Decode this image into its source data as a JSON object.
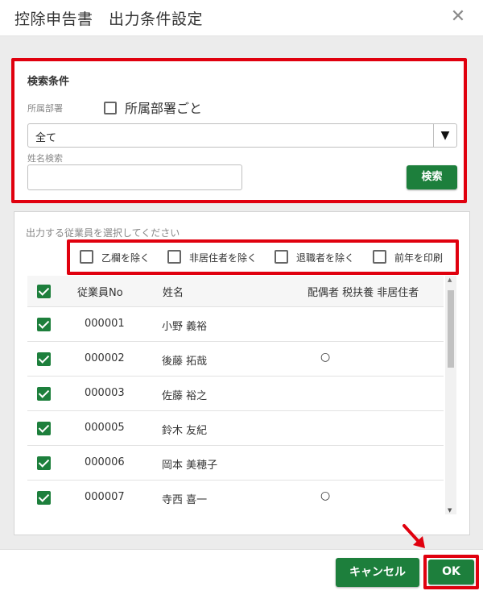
{
  "dialog": {
    "title": "控除申告書　出力条件設定",
    "close_icon": "close-icon"
  },
  "search": {
    "heading": "検索条件",
    "department_label": "所属部署",
    "per_department_label": "所属部署ごと",
    "per_department_checked": false,
    "department_value": "全て",
    "name_search_label": "姓名検索",
    "name_search_value": "",
    "search_button": "検索"
  },
  "employees": {
    "heading": "出力する従業員を選択してください",
    "filters": [
      {
        "label": "乙欄を除く",
        "checked": false
      },
      {
        "label": "非居住者を除く",
        "checked": false
      },
      {
        "label": "退職者を除く",
        "checked": false
      },
      {
        "label": "前年を印刷",
        "checked": false
      }
    ],
    "columns": {
      "no": "従業員No",
      "name": "姓名",
      "flags": "配偶者 税扶養 非居住者"
    },
    "select_all_checked": true,
    "rows": [
      {
        "no": "000001",
        "name": "小野 義裕",
        "mark": "",
        "checked": true
      },
      {
        "no": "000002",
        "name": "後藤 拓哉",
        "mark": "○",
        "checked": true
      },
      {
        "no": "000003",
        "name": "佐藤 裕之",
        "mark": "",
        "checked": true
      },
      {
        "no": "000005",
        "name": "鈴木 友紀",
        "mark": "",
        "checked": true
      },
      {
        "no": "000006",
        "name": "岡本 美穂子",
        "mark": "",
        "checked": true
      },
      {
        "no": "000007",
        "name": "寺西 喜一",
        "mark": "○",
        "checked": true
      }
    ]
  },
  "footer": {
    "cancel_button": "キャンセル",
    "ok_button": "OK"
  },
  "colors": {
    "accent_green": "#1d7f3c",
    "highlight_red": "#e0000e"
  }
}
